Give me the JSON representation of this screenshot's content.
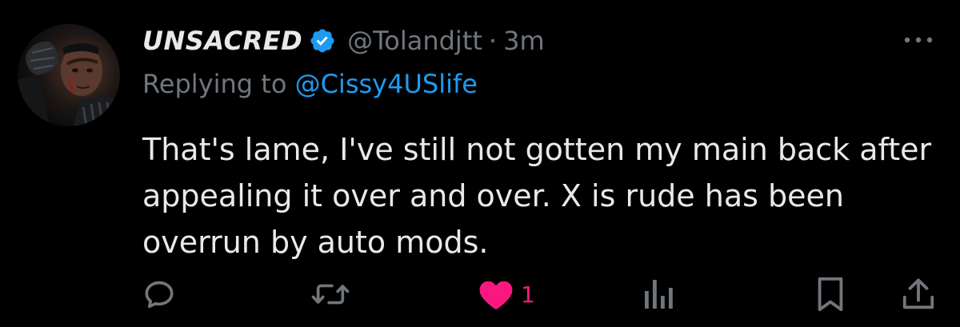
{
  "tweet": {
    "author": {
      "display_name": "UNSACRED",
      "handle": "@Tolandjtt",
      "verified": true,
      "avatar": "user-avatar-photo"
    },
    "separator": "·",
    "timestamp": "3m",
    "reply_to": {
      "prefix": "Replying to",
      "handle": "@Cissy4USlife"
    },
    "body": "That's lame, I've still not gotten my main back after appealing it over and over. X is rude has been overrun by auto mods.",
    "actions": {
      "reply_icon": "comment-bubble-icon",
      "retweet_icon": "retweet-arrows-icon",
      "like_icon": "heart-filled-icon",
      "like_count": "1",
      "views_icon": "bar-chart-icon",
      "bookmark_icon": "bookmark-icon",
      "share_icon": "share-upload-icon"
    },
    "more_icon": "more-dots-icon"
  },
  "colors": {
    "background": "#000000",
    "text_primary": "#e7e9ea",
    "text_secondary": "#71767b",
    "link_blue": "#1d9bf0",
    "verified_blue": "#1d9bf0",
    "like_pink": "#f91880"
  }
}
